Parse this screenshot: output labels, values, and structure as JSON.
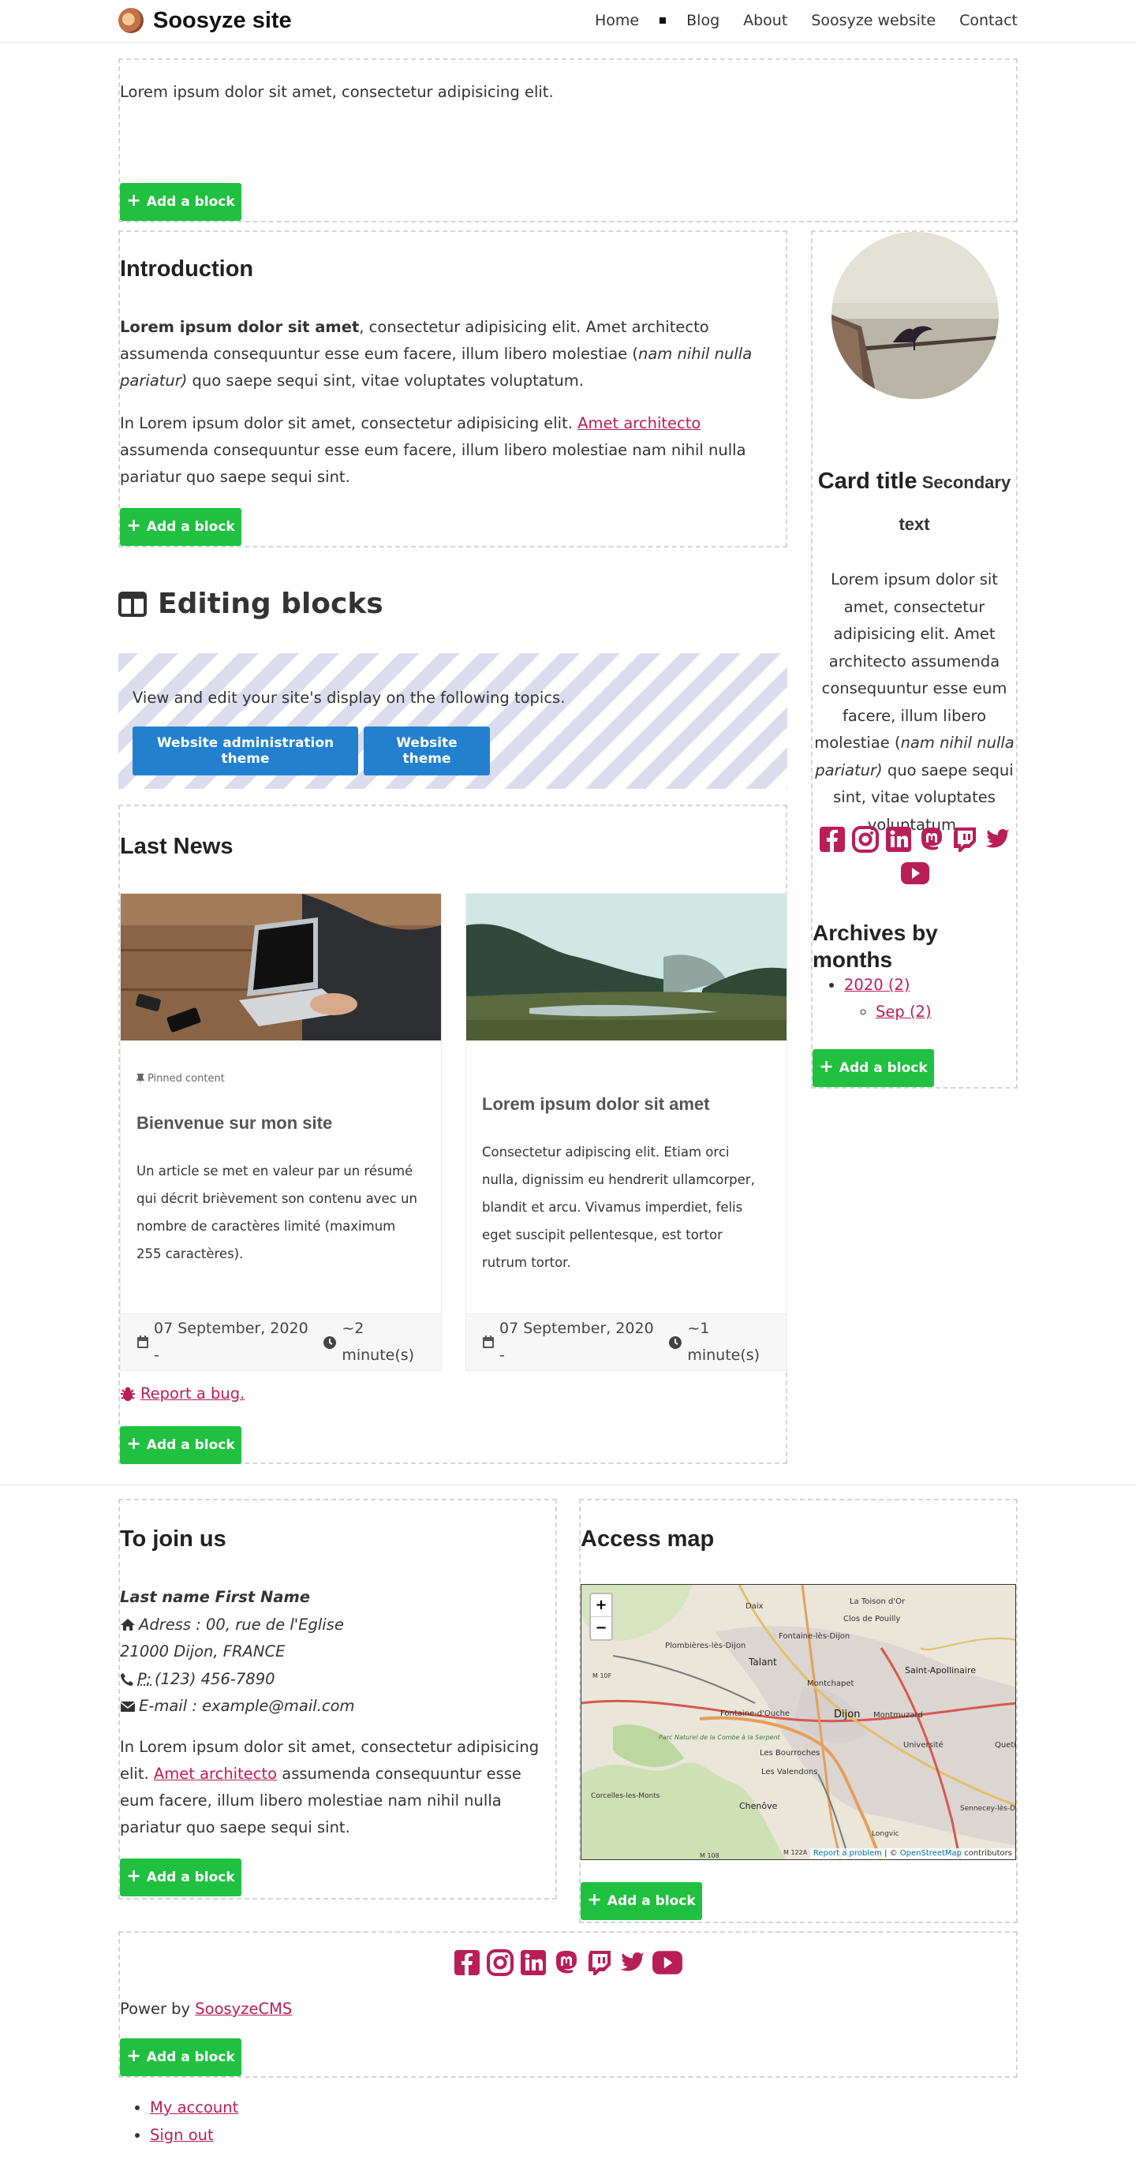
{
  "header": {
    "site_title": "Soosyze site",
    "nav": [
      "Home",
      "Blog",
      "About",
      "Soosyze website",
      "Contact"
    ]
  },
  "top_block": {
    "text": "Lorem ipsum dolor sit amet, consectetur adipisicing elit."
  },
  "add_block_label": "Add a block",
  "intro": {
    "title": "Introduction",
    "p1_bold": "Lorem ipsum dolor sit amet",
    "p1_a": ", consectetur adipisicing elit. Amet architecto assumenda consequuntur esse eum facere, illum libero molestiae (",
    "p1_em": "nam nihil nulla pariatur)",
    "p1_b": " quo saepe sequi sint, vitae voluptates voluptatum.",
    "p2_a": "In Lorem ipsum dolor sit amet, consectetur adipisicing elit. ",
    "p2_link": "Amet architecto",
    "p2_b": " assumenda consequuntur esse eum facere, illum libero molestiae nam nihil nulla pariatur quo saepe sequi sint."
  },
  "editing": {
    "title": "Editing blocks",
    "text": "View and edit your site's display on the following topics.",
    "btn_admin_theme": "Website administration theme",
    "btn_theme": "Website theme"
  },
  "news": {
    "title": "Last News",
    "cards": [
      {
        "pinned": "Pinned content",
        "title": "Bienvenue sur mon site",
        "text": "Un article se met en valeur par un résumé qui décrit brièvement son contenu avec un nombre de caractères limité (maximum 255 caractères).",
        "date": "07 September, 2020 -",
        "read": "~2 minute(s)"
      },
      {
        "title": "Lorem ipsum dolor sit amet",
        "text": "Consectetur adipiscing elit. Etiam orci nulla, dignissim eu hendrerit ullamcorper, blandit et arcu. Vivamus imperdiet, felis eget suscipit pellentesque, est tortor rutrum tortor.",
        "date": "07 September, 2020 -",
        "read": "~1 minute(s)"
      }
    ],
    "report_bug": "Report a bug."
  },
  "sidebar": {
    "card_title": "Card title",
    "card_secondary": "Secondary text",
    "card_text_a": "Lorem ipsum dolor sit amet, consectetur adipisicing elit. Amet architecto assumenda consequuntur esse eum facere, illum libero molestiae (",
    "card_text_em": "nam nihil nulla pariatur)",
    "card_text_b": " quo saepe sequi sint, vitae voluptates voluptatum.",
    "archives_title": "Archives by months",
    "archive_year": "2020 (2)",
    "archive_month": "Sep (2)"
  },
  "footer": {
    "join_title": "To join us",
    "name": "Last name First Name",
    "address1": "Adress : 00, rue de l'Eglise",
    "address2": "21000 Dijon, FRANCE",
    "phone_abbr": "P:",
    "phone": " (123) 456-7890",
    "email": "E-mail : example@mail.com",
    "p_a": "In Lorem ipsum dolor sit amet, consectetur adipisicing elit. ",
    "p_link": "Amet architecto",
    "p_b": " assumenda consequuntur esse eum facere, illum libero molestiae nam nihil nulla pariatur quo saepe sequi sint.",
    "map_title": "Access map",
    "map_zoom_in": "+",
    "map_zoom_out": "−",
    "map_attribution_link": "Report a problem",
    "map_attribution_sep": " | © ",
    "map_attribution_osm": "OpenStreetMap",
    "map_attribution_tail": " contributors",
    "map_places": [
      "Daix",
      "La Toison d'Or",
      "Clos de Pouilly",
      "Fontaine-lès-Dijon",
      "Plombières-lès-Dijon",
      "Talant",
      "Montchapet",
      "Saint-Apollinaire",
      "Fontaine-d'Ouche",
      "Dijon",
      "Montmuzard",
      "Quetigny",
      "Université",
      "Les Bourroches",
      "Parc Naturel de la Combe à la Serpent",
      "Les Valendons",
      "Corcelles-les-Monts",
      "Chenôve",
      "Longvic",
      "Sennecey-lès-Dijon",
      "M 10F",
      "M 108",
      "M 122A"
    ],
    "powered_by": "Power by ",
    "powered_link": "SoosyzeCMS",
    "account_links": [
      "My account",
      "Sign out"
    ]
  },
  "colors": {
    "accent": "#b91e56",
    "add_block": "#20c040",
    "theme_button": "#2280cf",
    "dashed_border": "#d4d4d4"
  }
}
